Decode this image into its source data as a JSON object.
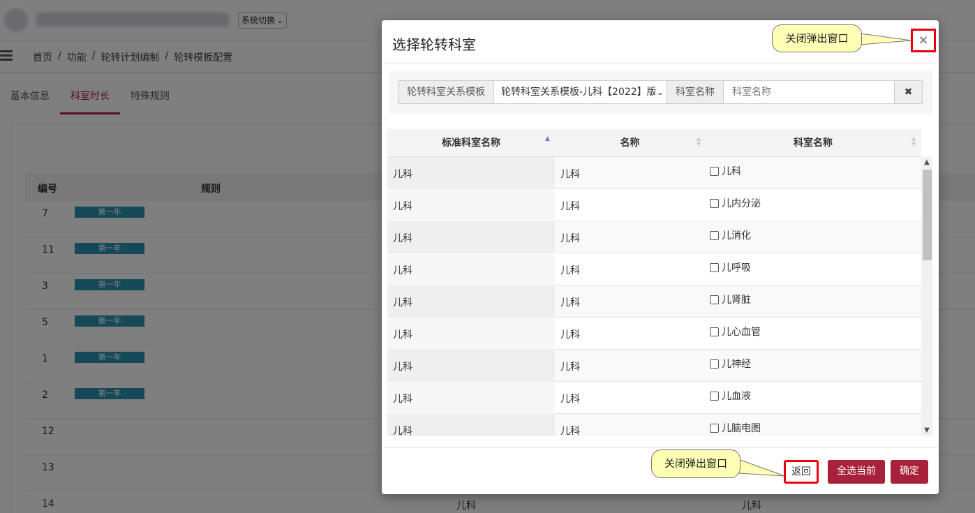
{
  "topbar": {
    "system_switch_label": "系统切换"
  },
  "breadcrumb": {
    "items": [
      "首页",
      "功能",
      "轮转计划编制",
      "轮转模板配置"
    ],
    "separator": "/"
  },
  "tabs": [
    {
      "label": "基本信息",
      "active": false
    },
    {
      "label": "科室时长",
      "active": true
    },
    {
      "label": "特殊规则",
      "active": false
    }
  ],
  "background_table": {
    "headers": {
      "num": "编号",
      "rule": "规则"
    },
    "rows": [
      {
        "num": "7",
        "tag": "第一年"
      },
      {
        "num": "11",
        "tag": "第一年"
      },
      {
        "num": "3",
        "tag": "第一年"
      },
      {
        "num": "5",
        "tag": "第一年"
      },
      {
        "num": "1",
        "tag": "第一年"
      },
      {
        "num": "2",
        "tag": "第一年"
      },
      {
        "num": "12",
        "tag": ""
      },
      {
        "num": "13",
        "tag": ""
      },
      {
        "num": "14",
        "tag": "",
        "c2": "儿科",
        "c3": "儿科"
      }
    ]
  },
  "modal": {
    "title": "选择轮转科室",
    "close_label": "×",
    "filter": {
      "template_label": "轮转科室关系模板",
      "template_value": "轮转科室关系模板-儿科【2022】版",
      "dept_label": "科室名称",
      "dept_placeholder": "科室名称",
      "clear_label": "✖"
    },
    "table": {
      "headers": [
        "标准科室名称",
        "名称",
        "科室名称"
      ],
      "rows": [
        {
          "std": "儿科",
          "name": "儿科",
          "dept": "儿科"
        },
        {
          "std": "儿科",
          "name": "儿科",
          "dept": "儿内分泌"
        },
        {
          "std": "儿科",
          "name": "儿科",
          "dept": "儿消化"
        },
        {
          "std": "儿科",
          "name": "儿科",
          "dept": "儿呼吸"
        },
        {
          "std": "儿科",
          "name": "儿科",
          "dept": "儿肾脏"
        },
        {
          "std": "儿科",
          "name": "儿科",
          "dept": "儿心血管"
        },
        {
          "std": "儿科",
          "name": "儿科",
          "dept": "儿神经"
        },
        {
          "std": "儿科",
          "name": "儿科",
          "dept": "儿血液"
        },
        {
          "std": "儿科",
          "name": "儿科",
          "dept": "儿脑电图"
        }
      ]
    },
    "footer": {
      "back_label": "返回",
      "select_all_label": "全选当前",
      "confirm_label": "确定"
    }
  },
  "callouts": {
    "top": "关闭弹出窗口",
    "bottom": "关闭弹出窗口"
  },
  "colors": {
    "accent": "#a8213a",
    "highlight_border": "#e8000b",
    "callout_bg": "#ffffb6",
    "tag_bg": "#2a93b0"
  }
}
